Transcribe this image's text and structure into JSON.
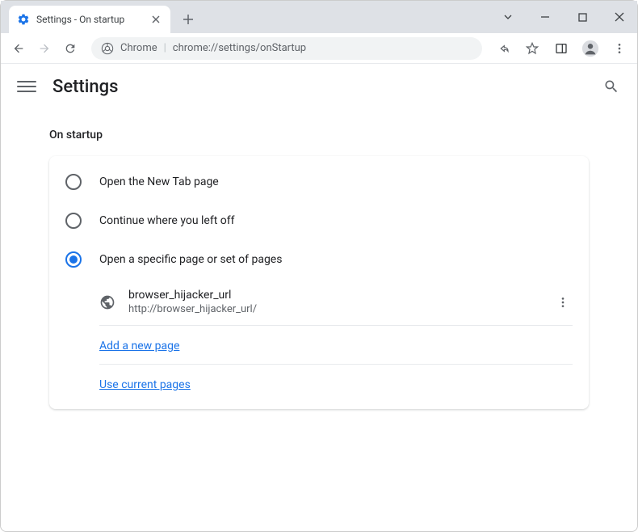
{
  "tab": {
    "title": "Settings - On startup"
  },
  "omnibox": {
    "prefix": "Chrome",
    "url": "chrome://settings/onStartup"
  },
  "header": {
    "title": "Settings"
  },
  "section": {
    "title": "On startup",
    "options": [
      {
        "label": "Open the New Tab page"
      },
      {
        "label": "Continue where you left off"
      },
      {
        "label": "Open a specific page or set of pages"
      }
    ],
    "pages": [
      {
        "name": "browser_hijacker_url",
        "url": "http://browser_hijacker_url/"
      }
    ],
    "add_link": "Add a new page",
    "use_current_link": "Use current pages"
  }
}
